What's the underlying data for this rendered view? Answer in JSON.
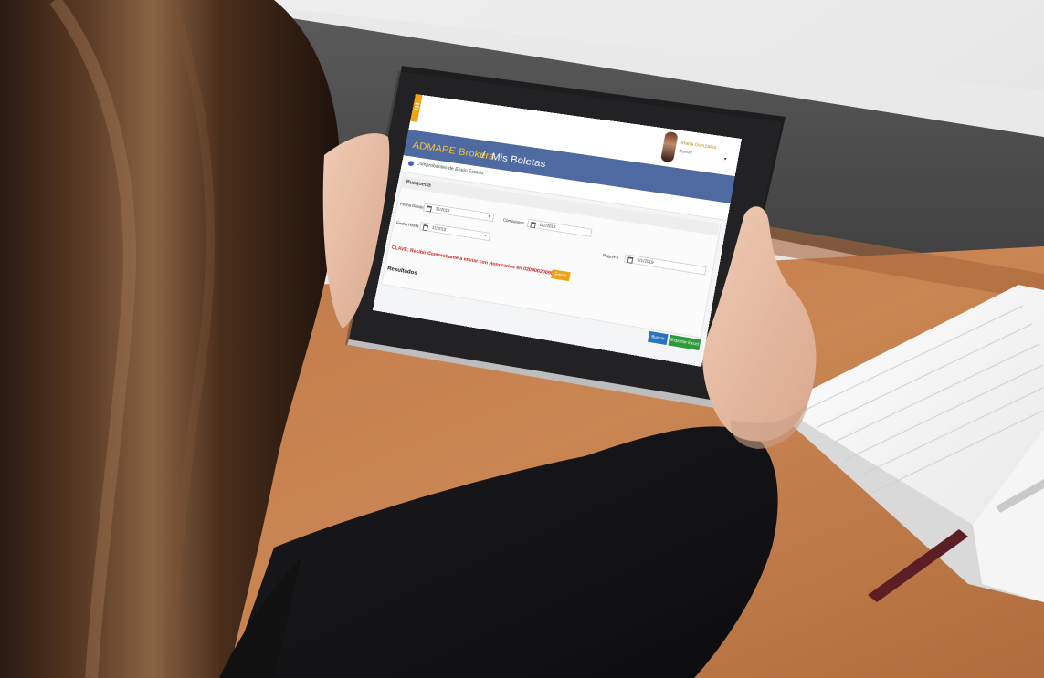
{
  "photo": {
    "subject": "person-with-tablet-icon",
    "tablet_screen": {
      "app_title": "ADMAPE Brokers",
      "title_separator": "/",
      "section": "Mis Boletas",
      "menu_icon": "hamburger-menu-icon",
      "user": {
        "name": "Maria Gonzalez",
        "role": "Asesor"
      },
      "section_label": "Comprobantes de Envío Estado",
      "panel_title": "Busqueda",
      "fields": [
        {
          "label": "Fecha Desde",
          "value": "11/2019",
          "icon": "calendar-icon"
        },
        {
          "label": "Fecha Hasta",
          "value": "11/2019",
          "icon": "calendar-icon"
        },
        {
          "label": "Comisiones",
          "value": "0/1/2019",
          "icon": "calendar-icon"
        },
        {
          "label": "Pago/Fe",
          "value": "0/1/2019",
          "icon": "calendar-icon"
        }
      ],
      "notice": "CLAVE: Recibir Comprobante a enviar con Honorarios en 0209002009N 01/01",
      "notice_button": "Enviar",
      "results_label": "Resultados",
      "buttons": {
        "primary": "Buscar",
        "secondary": "Exportar Excel"
      }
    }
  }
}
